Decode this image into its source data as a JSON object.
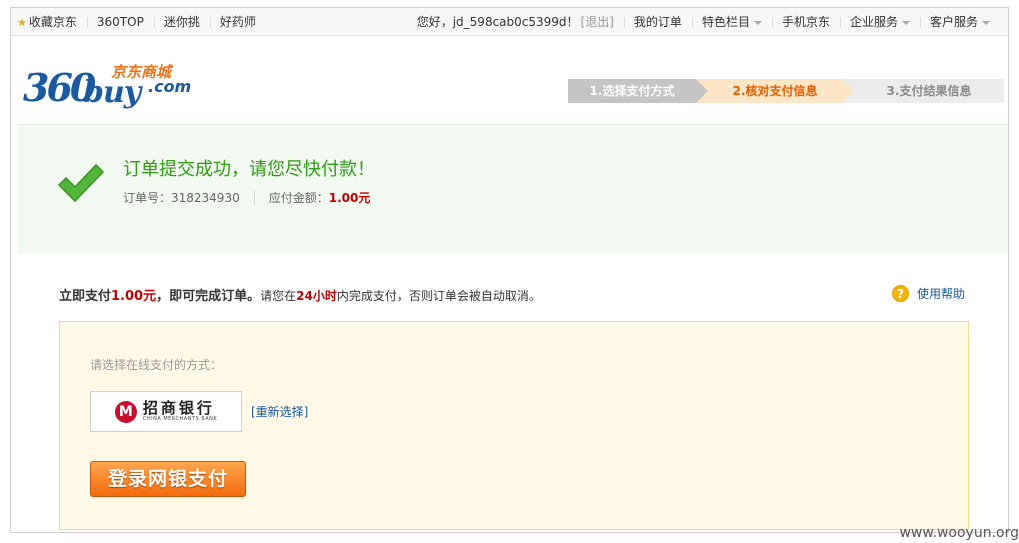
{
  "topbar": {
    "left": [
      "收藏京东",
      "360TOP",
      "迷你挑",
      "好药师"
    ],
    "greeting": "您好，jd_598cab0c5399d！",
    "logout": "[退出]",
    "my_orders": "我的订单",
    "special": "特色栏目",
    "mobile": "手机京东",
    "enterprise": "企业服务",
    "customer": "客户服务"
  },
  "logo": {
    "num": "360",
    "buy": "buy",
    "cn": "京东商城",
    "com": ".com"
  },
  "steps": [
    {
      "label": "1.选择支付方式"
    },
    {
      "label": "2.核对支付信息"
    },
    {
      "label": "3.支付结果信息"
    }
  ],
  "success": {
    "title": "订单提交成功，请您尽快付款！",
    "order_label": "订单号：318234930",
    "amount_label": "应付金额：",
    "amount": "1.00元"
  },
  "payline": {
    "prefix": "立即支付",
    "amount": "1.00元",
    "suffix": "，即可完成订单。",
    "note_a": "请您在",
    "hours": "24小时",
    "note_b": "内完成支付，否则订单会被自动取消。",
    "help": "使用帮助"
  },
  "panel": {
    "label": "请选择在线支付的方式：",
    "bank_cn": "招商银行",
    "bank_en": "CHINA MERCHANTS BANK",
    "reselect": "[重新选择]",
    "pay_button": "登录网银支付"
  },
  "watermark": "www.wooyun.org",
  "icons": {
    "star": "star-icon",
    "check": "checkmark-icon",
    "help": "question-icon",
    "bank": "cmb-logo-icon"
  }
}
